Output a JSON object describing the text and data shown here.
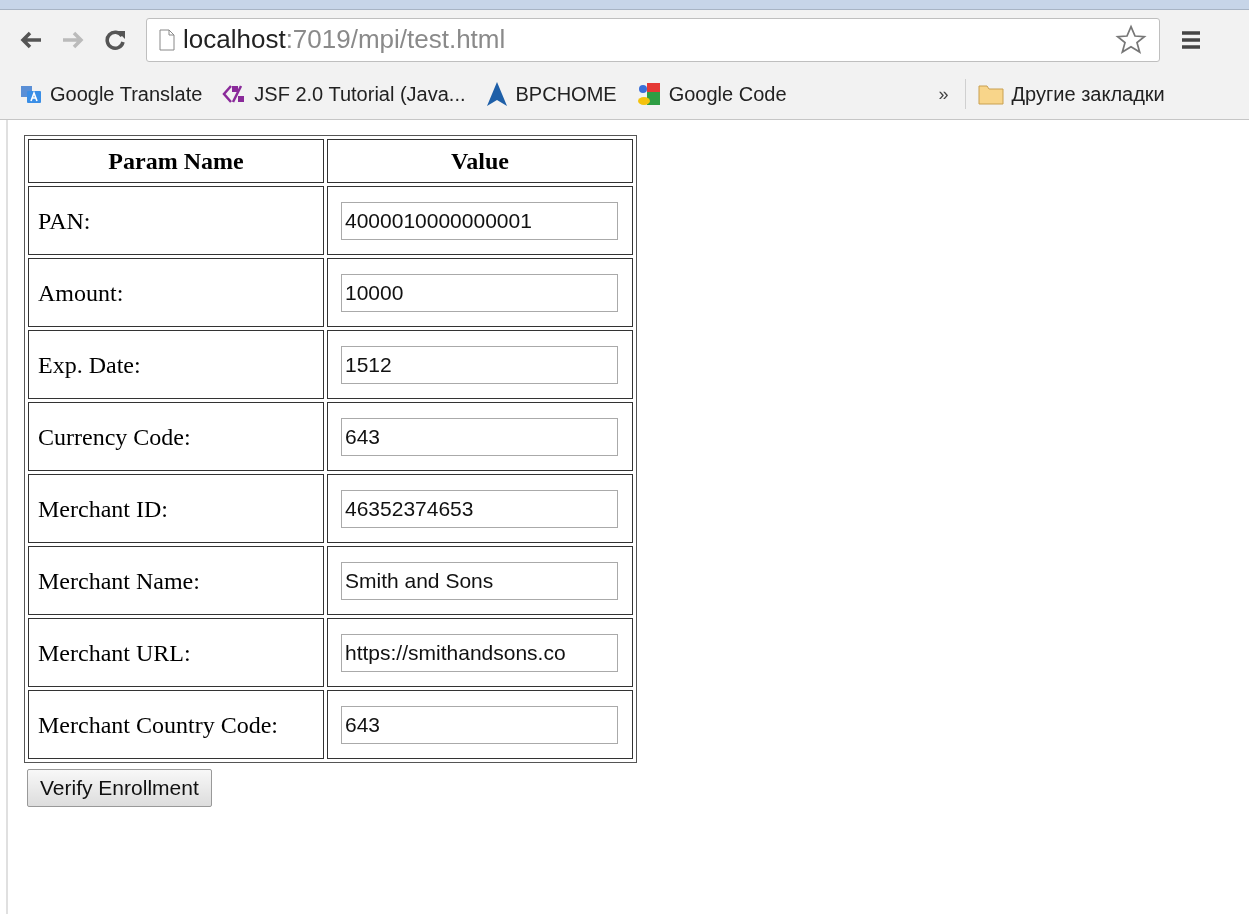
{
  "address_bar": {
    "host": "localhost",
    "path": ":7019/mpi/test.html"
  },
  "bookmarks": [
    {
      "label": "Google Translate",
      "kind": "translate"
    },
    {
      "label": "JSF 2.0 Tutorial (Java...",
      "kind": "jsf"
    },
    {
      "label": "BPCHOME",
      "kind": "arrow"
    },
    {
      "label": "Google Code",
      "kind": "code"
    }
  ],
  "overflow": "»",
  "other_bookmarks": "Другие закладки",
  "table": {
    "columns": [
      "Param Name",
      "Value"
    ],
    "rows": [
      {
        "label": "PAN:",
        "value": "4000010000000001"
      },
      {
        "label": "Amount:",
        "value": "10000"
      },
      {
        "label": "Exp. Date:",
        "value": "1512"
      },
      {
        "label": "Currency Code:",
        "value": "643"
      },
      {
        "label": "Merchant ID:",
        "value": "46352374653"
      },
      {
        "label": "Merchant Name:",
        "value": "Smith and Sons"
      },
      {
        "label": "Merchant URL:",
        "value": "https://smithandsons.co"
      },
      {
        "label": "Merchant Country Code:",
        "value": "643"
      }
    ]
  },
  "submit_button": "Verify Enrollment"
}
